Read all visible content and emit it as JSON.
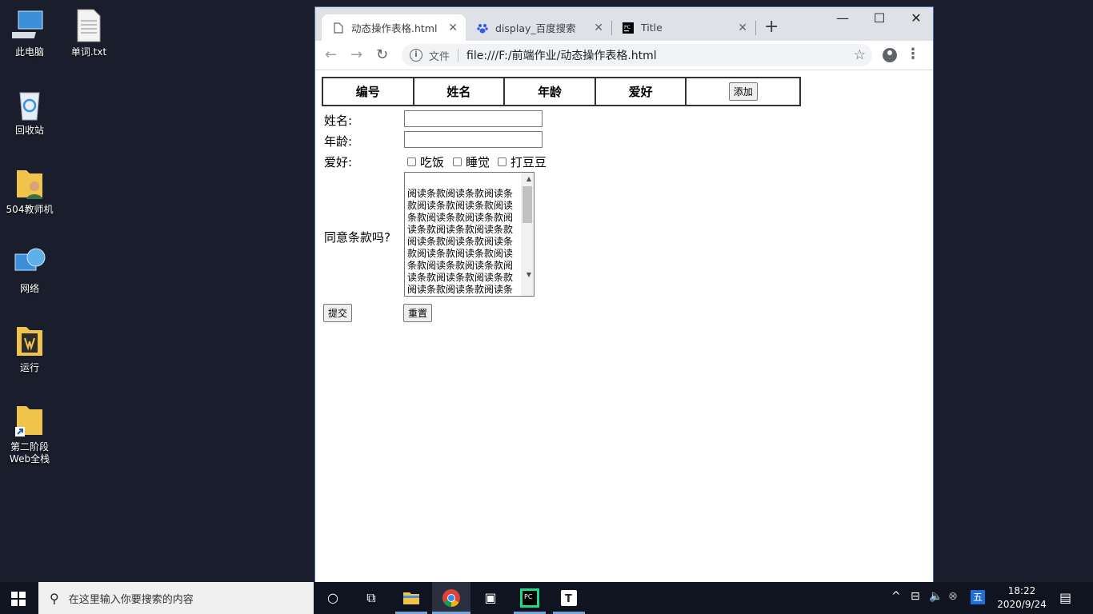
{
  "desktop": {
    "icons": [
      {
        "label": "此电脑",
        "icon": "computer-icon"
      },
      {
        "label": "单词.txt",
        "icon": "text-file-icon"
      },
      {
        "label": "回收站",
        "icon": "recycle-bin-icon"
      },
      {
        "label": "504教师机",
        "icon": "user-folder-icon"
      },
      {
        "label": "网络",
        "icon": "network-icon"
      },
      {
        "label": "运行",
        "icon": "run-folder-icon"
      },
      {
        "label": "第二阶段\nWeb全栈",
        "icon": "folder-shortcut-icon"
      }
    ]
  },
  "browser": {
    "tabs": [
      {
        "title": "动态操作表格.html",
        "icon": "page-icon",
        "active": true
      },
      {
        "title": "display_百度搜索",
        "icon": "baidu-paw-icon",
        "active": false
      },
      {
        "title": "Title",
        "icon": "pycharm-icon",
        "active": false
      }
    ],
    "address": {
      "scheme_label": "文件",
      "url": "file:///F:/前端作业/动态操作表格.html"
    }
  },
  "page": {
    "table_headers": [
      "编号",
      "姓名",
      "年龄",
      "爱好"
    ],
    "add_button": "添加",
    "form": {
      "name_label": "姓名:",
      "age_label": "年龄:",
      "hobby_label": "爱好:",
      "hobbies": [
        "吃饭",
        "睡觉",
        "打豆豆"
      ],
      "terms_label": "同意条款吗?",
      "terms_text": "阅读条款阅读条款阅读条款阅读条款阅读条款阅读条款阅读条款阅读条款阅读条款阅读条款阅读条款阅读条款阅读条款阅读条款阅读条款阅读条款阅读条款阅读条款阅读条款阅读条款阅读条款阅读条款阅读条款阅读条款阅读条款阅读条款阅读条款阅读条款阅读条款阅读条款阅读条款阅读条款阅读条款阅读条款阅读条款阅读条款",
      "submit_label": "提交",
      "reset_label": "重置"
    }
  },
  "taskbar": {
    "search_placeholder": "在这里输入你要搜索的内容",
    "ime": "五",
    "time": "18:22",
    "date": "2020/9/24"
  }
}
